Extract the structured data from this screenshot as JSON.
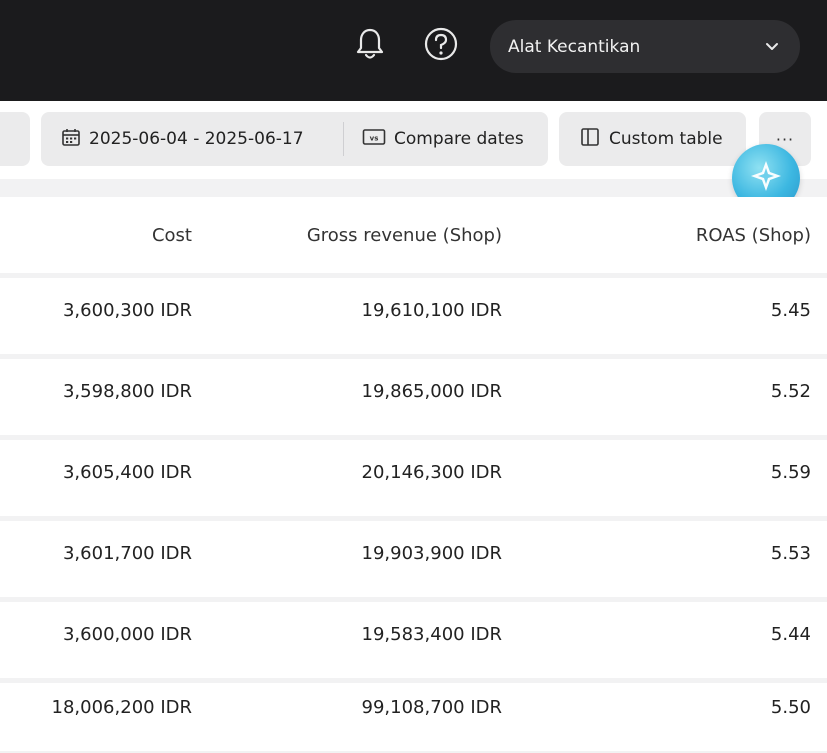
{
  "header": {
    "shop_selector": {
      "value": "Alat Kecantikan"
    },
    "icons": {
      "notifications": "bell-icon",
      "help": "help-icon",
      "dropdown": "chevron-down-icon"
    }
  },
  "toolbar": {
    "date_range": "2025-06-04 - 2025-06-17",
    "compare_label": "Compare dates",
    "custom_table_label": "Custom table",
    "more_label": "···"
  },
  "table": {
    "headers": {
      "cost": "Cost",
      "gross_revenue": "Gross revenue (Shop)",
      "roas": "ROAS (Shop)"
    },
    "rows": [
      {
        "cost": "3,600,300 IDR",
        "gross_revenue": "19,610,100 IDR",
        "roas": "5.45"
      },
      {
        "cost": "3,598,800 IDR",
        "gross_revenue": "19,865,000 IDR",
        "roas": "5.52"
      },
      {
        "cost": "3,605,400 IDR",
        "gross_revenue": "20,146,300 IDR",
        "roas": "5.59"
      },
      {
        "cost": "3,601,700 IDR",
        "gross_revenue": "19,903,900 IDR",
        "roas": "5.53"
      },
      {
        "cost": "3,600,000 IDR",
        "gross_revenue": "19,583,400 IDR",
        "roas": "5.44"
      }
    ],
    "total": {
      "cost": "18,006,200 IDR",
      "gross_revenue": "99,108,700 IDR",
      "roas": "5.50"
    }
  },
  "colors": {
    "topbar": "#1b1b1d",
    "select_bg": "#2e2e31",
    "assistant_accent": "#3cb7e1"
  }
}
